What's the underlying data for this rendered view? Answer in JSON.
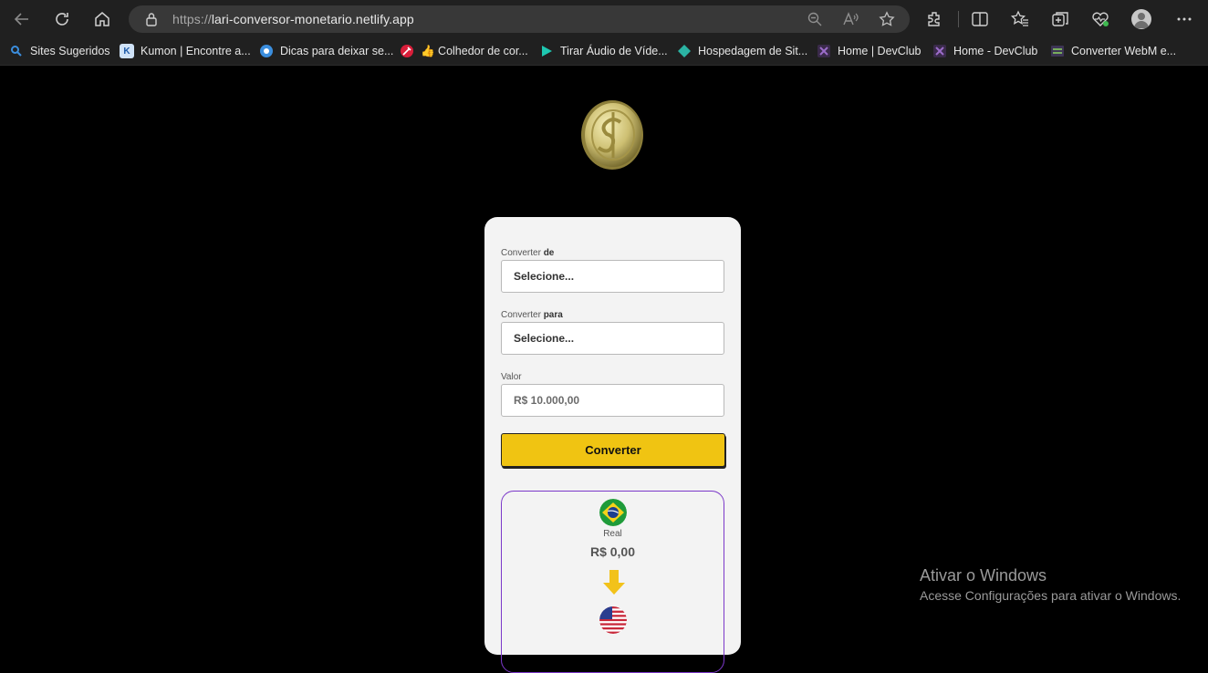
{
  "browser": {
    "url_protocol": "https://",
    "url_host": "lari-conversor-monetario.netlify.app"
  },
  "bookmarks": [
    {
      "label": "Sites Sugeridos",
      "icon": "search-icon"
    },
    {
      "label": "Kumon | Encontre a...",
      "icon": "k-icon"
    },
    {
      "label": "Dicas para deixar se...",
      "icon": "gear-icon"
    },
    {
      "label": "👍 Colhedor de cor...",
      "icon": "picker-icon"
    },
    {
      "label": "Tirar Áudio de Víde...",
      "icon": "play-icon"
    },
    {
      "label": "Hospedagem de Sit...",
      "icon": "diamond-icon"
    },
    {
      "label": "Home | DevClub",
      "icon": "devclub-icon"
    },
    {
      "label": "Home - DevClub",
      "icon": "devclub-icon"
    },
    {
      "label": "Converter WebM e...",
      "icon": "webm-icon"
    }
  ],
  "converter": {
    "from_label": "Converter ",
    "from_label_bold": "de",
    "from_value": "Selecione...",
    "to_label": "Converter ",
    "to_label_bold": "para",
    "to_value": "Selecione...",
    "amount_label": "Valor",
    "amount_placeholder": "R$ 10.000,00",
    "button_label": "Converter"
  },
  "result": {
    "source_currency": "Real",
    "source_value": "R$ 0,00"
  },
  "watermark": {
    "title": "Ativar o Windows",
    "subtitle": "Acesse Configurações para ativar o Windows."
  },
  "colors": {
    "button": "#f0c412",
    "result_border": "#7b38c9",
    "card": "#f3f3f3"
  }
}
